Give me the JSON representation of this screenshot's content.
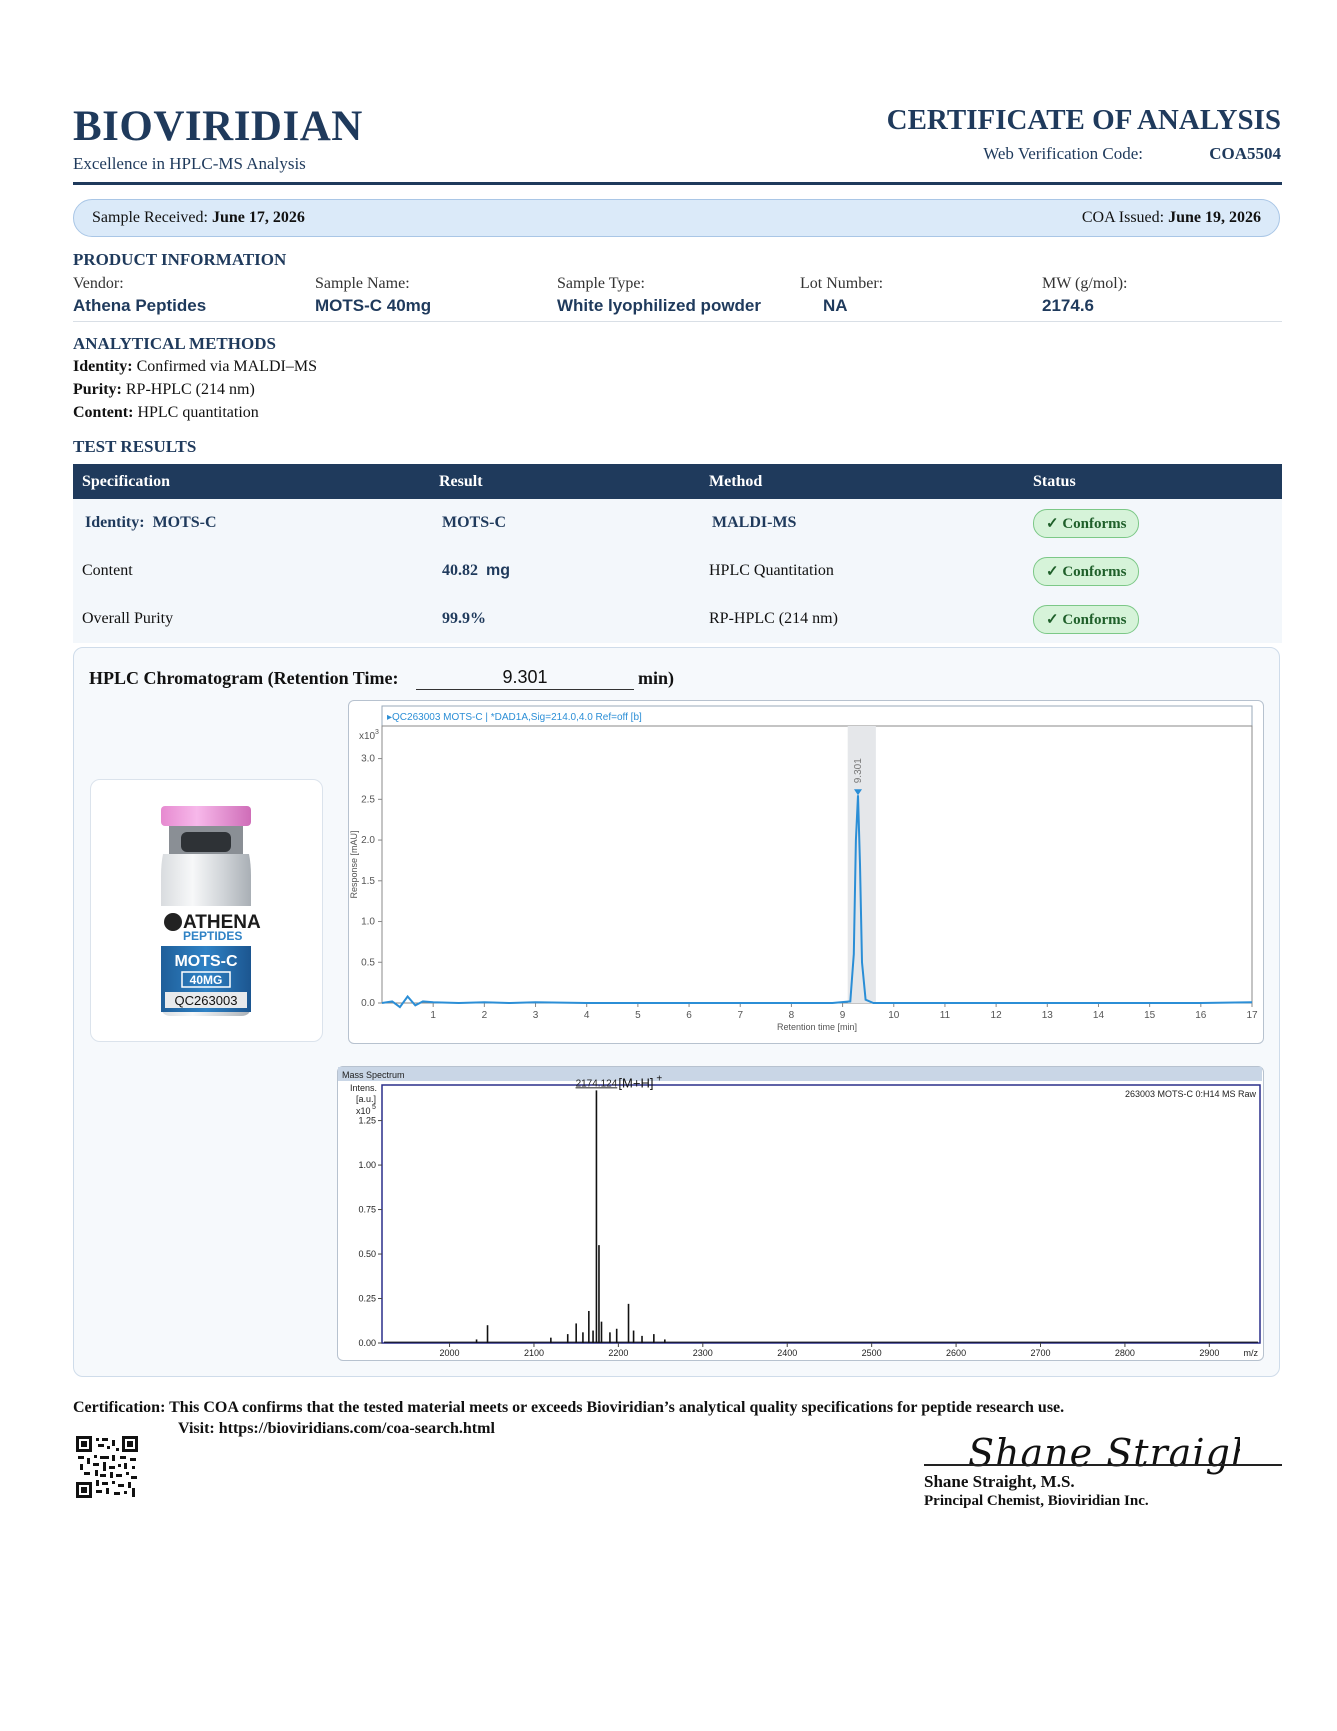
{
  "header": {
    "brand": "BIOVIRIDIAN",
    "tagline": "Excellence in HPLC-MS Analysis",
    "doc_title": "CERTIFICATE OF ANALYSIS",
    "web_code_label": "Web Verification Code:",
    "web_code": "COA5504"
  },
  "dates": {
    "received_label": "Sample Received:",
    "received": "June 17, 2026",
    "issued_label": "COA Issued:",
    "issued": "June 19, 2026"
  },
  "product": {
    "section_title": "PRODUCT INFORMATION",
    "fields": [
      {
        "label": "Vendor:",
        "value": "Athena Peptides"
      },
      {
        "label": "Sample Name:",
        "value": "MOTS-C 40mg"
      },
      {
        "label": "Sample Type:",
        "value": "White lyophilized powder"
      },
      {
        "label": "Lot Number:",
        "value": "NA"
      },
      {
        "label": "MW (g/mol):",
        "value": "2174.6"
      }
    ]
  },
  "methods": {
    "section_title": "ANALYTICAL METHODS",
    "items": [
      {
        "label": "Identity:",
        "value": "Confirmed via MALDI–MS"
      },
      {
        "label": "Purity:",
        "value": "RP-HPLC (214 nm)"
      },
      {
        "label": "Content:",
        "value": "HPLC quantitation"
      }
    ]
  },
  "results": {
    "section_title": "TEST RESULTS",
    "headers": [
      "Specification",
      "Result",
      "Method",
      "Status"
    ],
    "rows": [
      {
        "spec_label": "Identity:",
        "spec_value": "MOTS-C",
        "result": "MOTS-C",
        "result_unit": "",
        "method": "MALDI-MS",
        "status": "✓ Conforms"
      },
      {
        "spec_label": "Content",
        "spec_value": "",
        "result": "40.82",
        "result_unit": "mg",
        "method": "HPLC Quantitation",
        "status": "✓ Conforms"
      },
      {
        "spec_label": "Overall Purity",
        "spec_value": "",
        "result": "99.9%",
        "result_unit": "",
        "method": "RP-HPLC (214 nm)",
        "status": "✓ Conforms"
      }
    ]
  },
  "chromatogram": {
    "title": "HPLC Chromatogram (Retention Time:",
    "retention_time": "9.301",
    "unit": "min)"
  },
  "vial": {
    "brand_line1": "ATHENA",
    "brand_line2": "PEPTIDES",
    "product": "MOTS-C",
    "dose": "40MG",
    "lot": "QC263003"
  },
  "chart_data": [
    {
      "type": "line",
      "title": "QC263003 MOTS-C | *DAD1A,Sig=214.0,4.0 Ref=off [b]",
      "xlabel": "Retention time [min]",
      "ylabel": "Response [mAU]",
      "y_exponent": "x10",
      "y_exponent_power": "3",
      "xlim": [
        0,
        17
      ],
      "ylim": [
        0,
        3.4
      ],
      "x_ticks": [
        1,
        2,
        3,
        4,
        5,
        6,
        7,
        8,
        9,
        10,
        11,
        12,
        13,
        14,
        15,
        16,
        17
      ],
      "y_ticks": [
        "0.0",
        "0.5",
        "1.0",
        "1.5",
        "2.0",
        "2.5",
        "3.0"
      ],
      "peak_label": "9.301",
      "peak_x": 9.301,
      "peak_y": 2.55,
      "highlight_range": [
        9.1,
        9.65
      ],
      "colors": {
        "line": "#2b8ed6",
        "highlight": "#e5e7ea"
      },
      "series": [
        {
          "x": [
            0,
            0.2,
            0.35,
            0.5,
            0.65,
            0.8,
            1.0,
            1.5,
            2.0,
            2.5,
            3.0,
            4.0,
            5.0,
            6.0,
            7.0,
            8.0,
            8.8,
            9.15,
            9.22,
            9.26,
            9.301,
            9.34,
            9.38,
            9.45,
            9.6,
            10.0,
            11.0,
            12.0,
            13.0,
            14.0,
            15.0,
            16.0,
            17.0
          ],
          "y": [
            0.0,
            0.02,
            -0.05,
            0.08,
            -0.03,
            0.02,
            0.01,
            0.0,
            0.01,
            0.0,
            0.01,
            0.0,
            0.0,
            0.0,
            0.0,
            0.0,
            0.0,
            0.02,
            0.6,
            2.0,
            2.55,
            1.7,
            0.5,
            0.04,
            0.0,
            0.0,
            0.0,
            0.0,
            0.0,
            0.0,
            0.0,
            0.0,
            0.01
          ]
        }
      ]
    },
    {
      "type": "line",
      "title": "Mass Spectrum",
      "subtitle": "263003 MOTS-C 0:H14 MS Raw",
      "xlabel": "m/z",
      "ylabel": "Intens. [a.u.]",
      "y_exponent": "x10",
      "y_exponent_power": "5",
      "xlim": [
        1920,
        2960
      ],
      "ylim": [
        0,
        1.45
      ],
      "x_ticks": [
        2000,
        2100,
        2200,
        2300,
        2400,
        2500,
        2600,
        2700,
        2800,
        2900
      ],
      "y_ticks": [
        "0.00",
        "0.25",
        "0.50",
        "0.75",
        "1.00",
        "1.25"
      ],
      "peak_label": "2174.124",
      "peak_annotation": "[M+H]",
      "peak_annotation_sup": "+",
      "peaks": [
        {
          "x": 2032,
          "y": 0.02
        },
        {
          "x": 2045,
          "y": 0.1
        },
        {
          "x": 2120,
          "y": 0.03
        },
        {
          "x": 2140,
          "y": 0.05
        },
        {
          "x": 2150,
          "y": 0.11
        },
        {
          "x": 2158,
          "y": 0.06
        },
        {
          "x": 2165,
          "y": 0.18
        },
        {
          "x": 2170,
          "y": 0.07
        },
        {
          "x": 2174,
          "y": 1.42
        },
        {
          "x": 2177,
          "y": 0.55
        },
        {
          "x": 2180,
          "y": 0.12
        },
        {
          "x": 2190,
          "y": 0.06
        },
        {
          "x": 2198,
          "y": 0.08
        },
        {
          "x": 2212,
          "y": 0.22
        },
        {
          "x": 2218,
          "y": 0.07
        },
        {
          "x": 2228,
          "y": 0.04
        },
        {
          "x": 2242,
          "y": 0.05
        },
        {
          "x": 2255,
          "y": 0.02
        }
      ],
      "colors": {
        "line": "#111111",
        "frame": "#2a2f8a"
      }
    }
  ],
  "footer": {
    "certification": "Certification: This COA confirms that the tested material meets or exceeds Bioviridian’s analytical quality specifications for peptide research use.",
    "visit": "Visit: https://bioviridians.com/coa-search.html",
    "signature": "Shane Straight",
    "signer_name": "Shane Straight, M.S.",
    "signer_title": "Principal Chemist, Bioviridian Inc."
  }
}
